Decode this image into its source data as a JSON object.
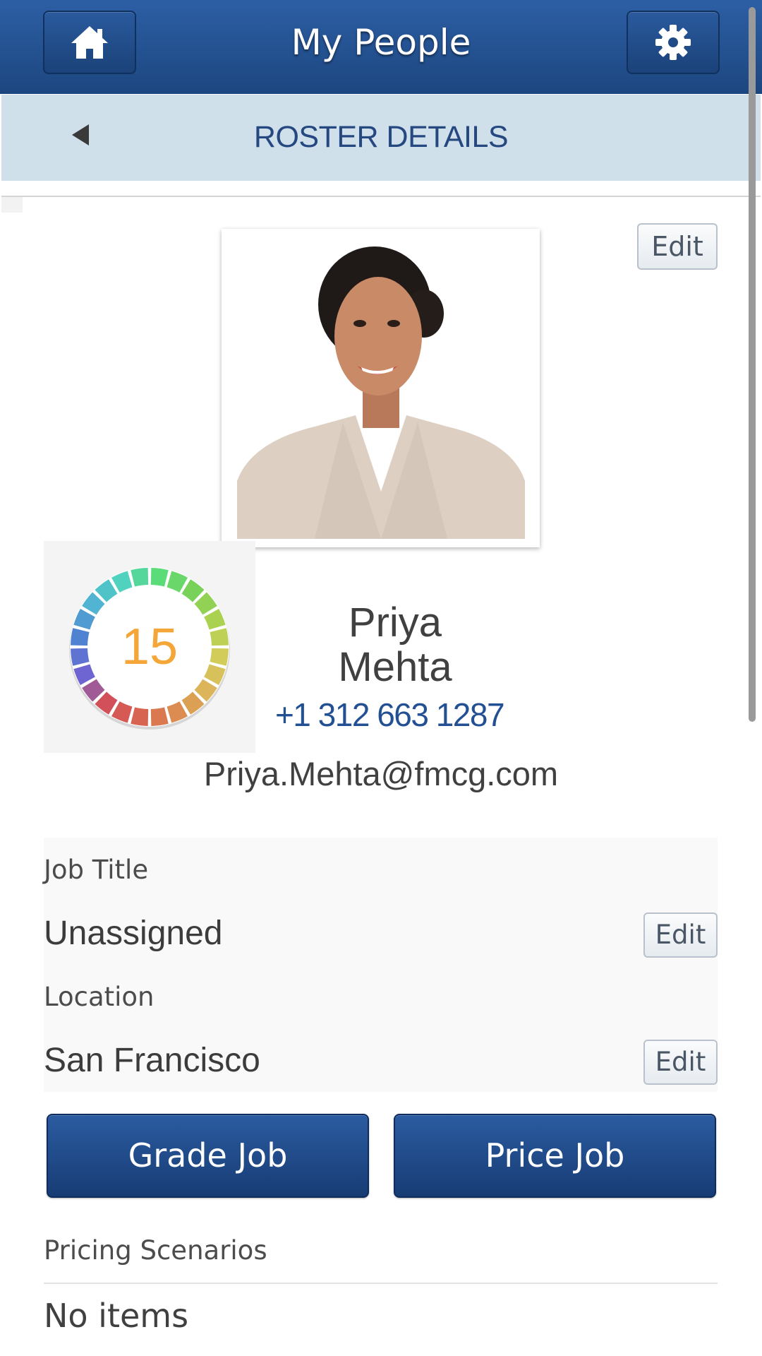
{
  "header": {
    "title": "My People",
    "home_icon": "home-icon",
    "settings_icon": "gear-icon"
  },
  "subheader": {
    "title": "ROSTER DETAILS",
    "back_icon": "back-arrow-icon"
  },
  "profile": {
    "photo_edit_label": "Edit",
    "score": "15",
    "first_name": "Priya",
    "last_name": "Mehta",
    "phone": "+1 312 663 1287",
    "email": "Priya.Mehta@fmcg.com"
  },
  "details": {
    "job_title_label": "Job Title",
    "job_title_value": "Unassigned",
    "job_title_edit": "Edit",
    "location_label": "Location",
    "location_value": "San Francisco",
    "location_edit": "Edit"
  },
  "actions": {
    "grade_label": "Grade Job",
    "price_label": "Price Job"
  },
  "pricing": {
    "section_label": "Pricing Scenarios",
    "empty_text": "No items"
  },
  "colors": {
    "header_bg": "#1f4b87",
    "subheader_bg": "#cfe0eb",
    "accent_text": "#24487f",
    "score_text": "#f4a638",
    "link_text": "#234f93"
  }
}
